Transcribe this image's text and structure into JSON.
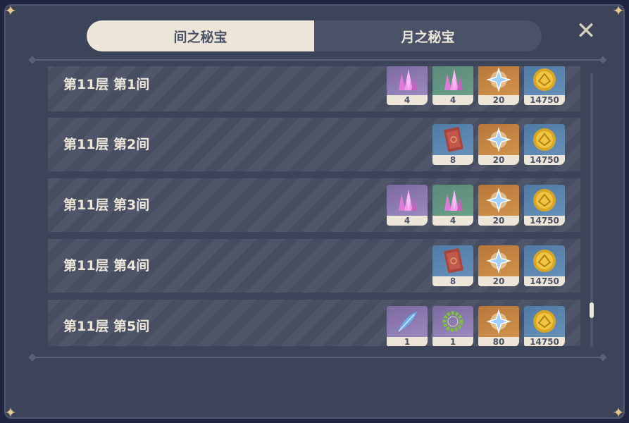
{
  "tabs": [
    {
      "label": "间之秘宝",
      "active": true
    },
    {
      "label": "月之秘宝",
      "active": false
    }
  ],
  "close_icon": "close-icon",
  "colors": {
    "panel": "#3c4459",
    "row": "#4a5165",
    "accent": "#ece5d8"
  },
  "rows": [
    {
      "label": "第11层 第1间",
      "rewards": [
        {
          "icon": "crystal-chunk-icon",
          "rarity": "purple",
          "count": "4"
        },
        {
          "icon": "crystal-chunk-icon",
          "rarity": "green",
          "count": "4"
        },
        {
          "icon": "primogem-icon",
          "rarity": "orange",
          "count": "20"
        },
        {
          "icon": "mora-icon",
          "rarity": "blue",
          "count": "14750"
        }
      ]
    },
    {
      "label": "第11层 第2间",
      "rewards": [
        {
          "icon": "ore-block-icon",
          "rarity": "blue",
          "count": "8"
        },
        {
          "icon": "primogem-icon",
          "rarity": "orange",
          "count": "20"
        },
        {
          "icon": "mora-icon",
          "rarity": "blue",
          "count": "14750"
        }
      ]
    },
    {
      "label": "第11层 第3间",
      "rewards": [
        {
          "icon": "crystal-chunk-icon",
          "rarity": "purple",
          "count": "4"
        },
        {
          "icon": "crystal-chunk-icon",
          "rarity": "green",
          "count": "4"
        },
        {
          "icon": "primogem-icon",
          "rarity": "orange",
          "count": "20"
        },
        {
          "icon": "mora-icon",
          "rarity": "blue",
          "count": "14750"
        }
      ]
    },
    {
      "label": "第11层 第4间",
      "rewards": [
        {
          "icon": "ore-block-icon",
          "rarity": "blue",
          "count": "8"
        },
        {
          "icon": "primogem-icon",
          "rarity": "orange",
          "count": "20"
        },
        {
          "icon": "mora-icon",
          "rarity": "blue",
          "count": "14750"
        }
      ]
    },
    {
      "label": "第11层 第5间",
      "rewards": [
        {
          "icon": "feather-icon",
          "rarity": "purple",
          "count": "1"
        },
        {
          "icon": "wreath-icon",
          "rarity": "purple",
          "count": "1"
        },
        {
          "icon": "primogem-icon",
          "rarity": "orange",
          "count": "80"
        },
        {
          "icon": "mora-icon",
          "rarity": "blue",
          "count": "14750"
        }
      ]
    }
  ]
}
